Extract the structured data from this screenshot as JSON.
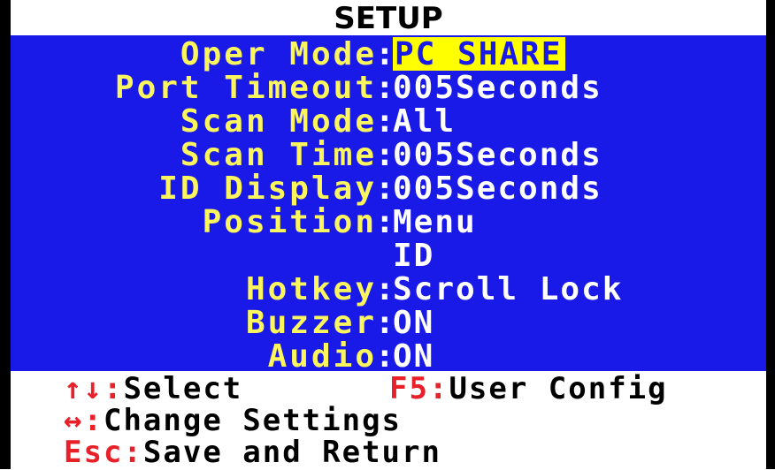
{
  "title": "SETUP",
  "settings": [
    {
      "label": "Oper Mode",
      "value": "PC SHARE",
      "selected": true
    },
    {
      "label": "Port Timeout",
      "value": "005Seconds",
      "selected": false
    },
    {
      "label": "Scan Mode",
      "value": "All",
      "selected": false
    },
    {
      "label": "Scan Time",
      "value": "005Seconds",
      "selected": false
    },
    {
      "label": "ID Display",
      "value": "005Seconds",
      "selected": false
    },
    {
      "label": "Position",
      "value": "Menu",
      "selected": false
    },
    {
      "label": "",
      "value": "ID",
      "selected": false
    },
    {
      "label": "Hotkey",
      "value": "Scroll Lock",
      "selected": false
    },
    {
      "label": "Buzzer",
      "value": "ON",
      "selected": false
    },
    {
      "label": "Audio",
      "value": "ON",
      "selected": false
    }
  ],
  "footer": {
    "select_key": "↑↓",
    "select_label": "Select",
    "config_key": "F5",
    "config_label": "User Config",
    "change_key": "↔",
    "change_label": "Change Settings",
    "esc_key": "Esc",
    "esc_label": "Save and Return"
  },
  "colors": {
    "panel": "#1a1ae8",
    "label": "#fbf65e",
    "value": "#ffffff",
    "highlight": "#ffff00",
    "key": "#e8202a"
  }
}
